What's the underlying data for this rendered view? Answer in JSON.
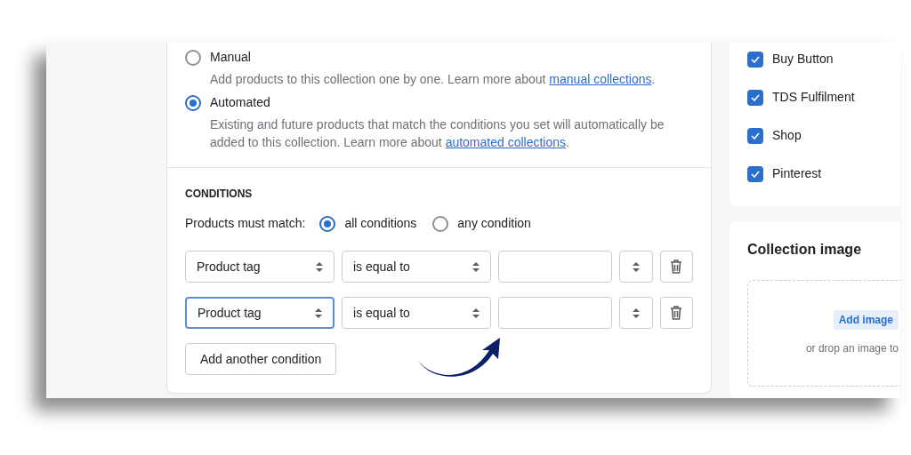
{
  "collection_type": [
    {
      "label": "Manual",
      "selected": false,
      "description": "Add products to this collection one by one. Learn more about ",
      "link": "manual collections",
      "description_end": "."
    },
    {
      "label": "Automated",
      "selected": true,
      "description": "Existing and future products that match the conditions you set will automatically be added to this collection. Learn more about ",
      "link": "automated collections",
      "description_end": "."
    }
  ],
  "conditions": {
    "title": "CONDITIONS",
    "match_label": "Products must match:",
    "match_options": [
      {
        "label": "all conditions",
        "selected": true
      },
      {
        "label": "any condition",
        "selected": false
      }
    ],
    "rows": [
      {
        "field": "Product tag",
        "operator": "is equal to",
        "focused": false
      },
      {
        "field": "Product tag",
        "operator": "is equal to",
        "focused": true
      }
    ],
    "add_button": "Add another condition"
  },
  "sales_channels": [
    {
      "label": "Buy Button",
      "checked": true
    },
    {
      "label": "TDS Fulfilment",
      "checked": true
    },
    {
      "label": "Shop",
      "checked": true
    },
    {
      "label": "Pinterest",
      "checked": true
    }
  ],
  "collection_image": {
    "title": "Collection image",
    "add_button": "Add image",
    "hint": "or drop an image to"
  }
}
